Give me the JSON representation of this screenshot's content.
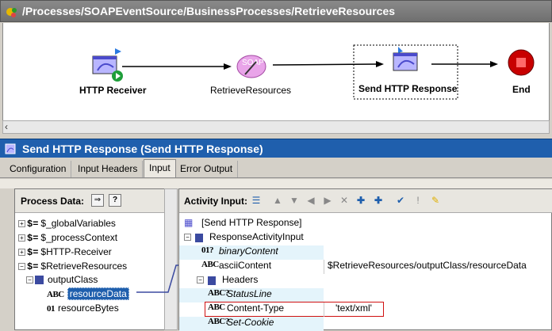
{
  "window": {
    "title": "/Processes/SOAPEventSource/BusinessProcesses/RetrieveResources"
  },
  "canvas": {
    "nodes": [
      {
        "label": "HTTP Receiver",
        "icon": "http-receiver-icon"
      },
      {
        "label": "RetrieveResources",
        "icon": "soap-icon"
      },
      {
        "label": "Send HTTP Response",
        "icon": "send-http-response-icon"
      },
      {
        "label": "End",
        "icon": "end-icon"
      }
    ]
  },
  "panel": {
    "title": "Send HTTP Response (Send HTTP Response)"
  },
  "tabs": [
    {
      "label": "Configuration"
    },
    {
      "label": "Input Headers"
    },
    {
      "label": "Input"
    },
    {
      "label": "Error Output"
    }
  ],
  "left": {
    "title": "Process Data:",
    "tree": [
      "$_globalVariables",
      "$_processContext",
      "$HTTP-Receiver",
      "$RetrieveResources",
      "outputClass",
      "resourceData",
      "resourceBytes"
    ]
  },
  "right": {
    "title": "Activity Input:",
    "rows": [
      {
        "name": "[Send HTTP Response]",
        "value": ""
      },
      {
        "name": "ResponseActivityInput",
        "value": ""
      },
      {
        "name": "binaryContent",
        "value": ""
      },
      {
        "name": "asciiContent",
        "value": "$RetrieveResources/outputClass/resourceData"
      },
      {
        "name": "Headers",
        "value": ""
      },
      {
        "name": "StatusLine",
        "value": ""
      },
      {
        "name": "Content-Type",
        "value": "'text/xml'"
      },
      {
        "name": "Set-Cookie",
        "value": ""
      }
    ]
  },
  "colors": {
    "panel_header": "#1f5fad",
    "selected": "#1f5fad",
    "highlight_box": "#d01010",
    "optional_cell": "#e4f4fb"
  }
}
